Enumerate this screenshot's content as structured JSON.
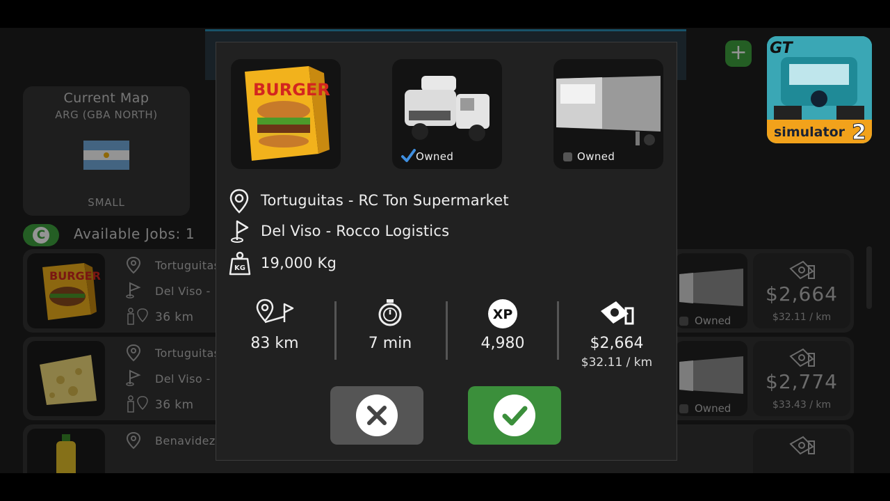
{
  "background": {
    "current_map": {
      "title": "Current Map",
      "region": "ARG (GBA NORTH)",
      "size": "SMALL"
    },
    "available_jobs_label": "Available Jobs: 1",
    "refresh_glyph": "C",
    "add_glyph": "+",
    "jobs": [
      {
        "origin": "Tortuguitas",
        "destination": "Del Viso -",
        "distance": "36 km",
        "cargo_icon": "burger-box",
        "owned": "Owned",
        "pay": "$2,664",
        "per_km": "$32.11 / km"
      },
      {
        "origin": "Tortuguitas",
        "destination": "Del Viso -",
        "distance": "36 km",
        "cargo_icon": "cheese",
        "owned": "Owned",
        "pay": "$2,774",
        "per_km": "$33.43 / km"
      },
      {
        "origin": "Benavidez",
        "destination": "",
        "distance": "",
        "cargo_icon": "oil-bottle",
        "owned": "",
        "pay": "",
        "per_km": ""
      }
    ]
  },
  "logo": {
    "top": "GT",
    "text": "simulator",
    "number": "2"
  },
  "cargo_label": "BURGER",
  "modal": {
    "truck_owned": "Owned",
    "trailer_owned": "Owned",
    "origin": "Tortuguitas - RC Ton Supermarket",
    "destination": "Del Viso - Rocco Logistics",
    "weight": "19,000 Kg",
    "weight_icon_label": "KG",
    "stats": {
      "distance": "83 km",
      "time": "7 min",
      "xp_label": "XP",
      "xp": "4,980",
      "pay": "$2,664",
      "per_km": "$32.11 / km"
    }
  },
  "colors": {
    "accent_green": "#3b8f3b",
    "modal_bg": "#212121",
    "cancel_gray": "#555555"
  }
}
